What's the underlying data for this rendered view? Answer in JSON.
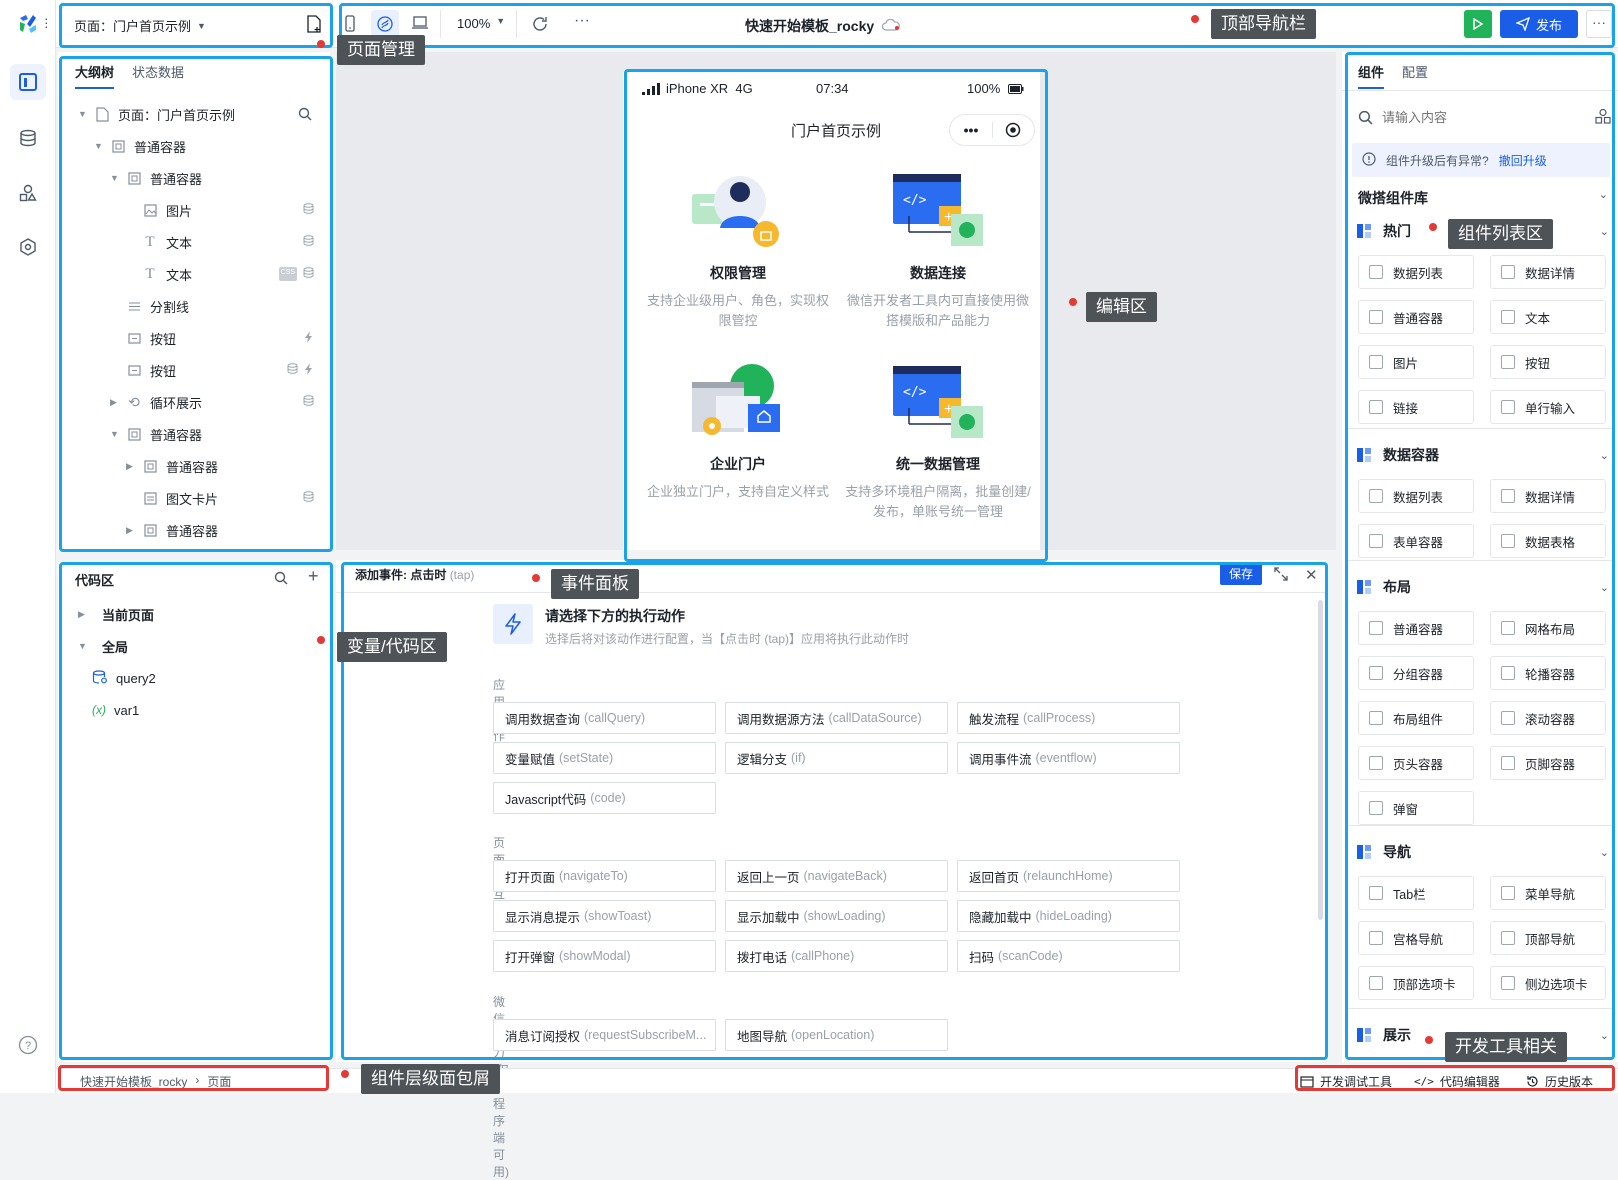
{
  "topbar": {
    "page_selector": "页面：门户首页示例",
    "zoom": "100%",
    "app_title": "快速开始模板_rocky",
    "publish_label": "发布"
  },
  "left_panel": {
    "tabs": [
      "大纲树",
      "状态数据"
    ],
    "tree": [
      {
        "label": "页面：门户首页示例",
        "depth": 0,
        "expand": "open",
        "icon": "page-icon"
      },
      {
        "label": "普通容器",
        "depth": 1,
        "expand": "open",
        "icon": "container-icon"
      },
      {
        "label": "普通容器",
        "depth": 2,
        "expand": "open",
        "icon": "container-icon"
      },
      {
        "label": "图片",
        "depth": 3,
        "expand": "none",
        "icon": "image-icon"
      },
      {
        "label": "文本",
        "depth": 3,
        "expand": "none",
        "icon": "text-icon"
      },
      {
        "label": "文本",
        "depth": 3,
        "expand": "none",
        "icon": "text-icon"
      },
      {
        "label": "分割线",
        "depth": 2,
        "expand": "none",
        "icon": "divider-icon"
      },
      {
        "label": "按钮",
        "depth": 2,
        "expand": "none",
        "icon": "button-icon"
      },
      {
        "label": "按钮",
        "depth": 2,
        "expand": "none",
        "icon": "button-icon"
      },
      {
        "label": "循环展示",
        "depth": 2,
        "expand": "closed",
        "icon": "loop-icon"
      },
      {
        "label": "普通容器",
        "depth": 2,
        "expand": "open",
        "icon": "container-icon"
      },
      {
        "label": "普通容器",
        "depth": 3,
        "expand": "closed",
        "icon": "container-icon"
      },
      {
        "label": "图文卡片",
        "depth": 3,
        "expand": "none",
        "icon": "card-icon"
      },
      {
        "label": "普通容器",
        "depth": 3,
        "expand": "closed",
        "icon": "container-icon"
      }
    ]
  },
  "code_panel": {
    "title": "代码区",
    "items": [
      {
        "label": "当前页面",
        "bold": true
      },
      {
        "label": "全局",
        "bold": true
      },
      {
        "label": "query2",
        "bold": false
      },
      {
        "label": "var1",
        "bold": false
      }
    ]
  },
  "phone": {
    "carrier": "iPhone XR  4G",
    "time": "07:34",
    "battery": "100%",
    "page_title": "门户首页示例",
    "features": [
      {
        "title": "权限管理",
        "desc": "支持企业级用户、角色，实现权限管控"
      },
      {
        "title": "数据连接",
        "desc": "微信开发者工具内可直接使用微搭模版和产品能力"
      },
      {
        "title": "企业门户",
        "desc": "企业独立门户，支持自定义样式"
      },
      {
        "title": "统一数据管理",
        "desc": "支持多环境租户隔离，批量创建/发布，单账号统一管理"
      }
    ]
  },
  "event_panel": {
    "title": "添加事件: 点击时",
    "title_api": "(tap)",
    "save_label": "保存",
    "heading": "请选择下方的执行动作",
    "subheading": "选择后将对该动作进行配置，当【点击时 (tap)】应用将执行此动作时",
    "sections": [
      {
        "title": "应用动作",
        "actions": [
          {
            "label": "调用数据查询",
            "api": "(callQuery)"
          },
          {
            "label": "调用数据源方法",
            "api": "(callDataSource)"
          },
          {
            "label": "触发流程",
            "api": "(callProcess)"
          },
          {
            "label": "变量赋值",
            "api": "(setState)"
          },
          {
            "label": "逻辑分支",
            "api": "(if)"
          },
          {
            "label": "调用事件流",
            "api": "(eventflow)"
          },
          {
            "label": "Javascript代码",
            "api": "(code)"
          }
        ]
      },
      {
        "title": "页面交互",
        "actions": [
          {
            "label": "打开页面",
            "api": "(navigateTo)"
          },
          {
            "label": "返回上一页",
            "api": "(navigateBack)"
          },
          {
            "label": "返回首页",
            "api": "(relaunchHome)"
          },
          {
            "label": "显示消息提示",
            "api": "(showToast)"
          },
          {
            "label": "显示加载中",
            "api": "(showLoading)"
          },
          {
            "label": "隐藏加载中",
            "api": "(hideLoading)"
          },
          {
            "label": "打开弹窗",
            "api": "(showModal)"
          },
          {
            "label": "拨打电话",
            "api": "(callPhone)"
          },
          {
            "label": "扫码",
            "api": "(scanCode)"
          }
        ]
      },
      {
        "title": "微信能力(仅小程序端可用)",
        "actions": [
          {
            "label": "消息订阅授权",
            "api": "(requestSubscribeM..."
          },
          {
            "label": "地图导航",
            "api": "(openLocation)"
          }
        ]
      }
    ]
  },
  "right_panel": {
    "tabs": [
      "组件",
      "配置"
    ],
    "search_placeholder": "请输入内容",
    "notice": "组件升级后有异常?",
    "notice_link": "撤回升级",
    "library_title": "微搭组件库",
    "categories": [
      {
        "title": "热门",
        "items": [
          "数据列表",
          "数据详情",
          "普通容器",
          "文本",
          "图片",
          "按钮",
          "链接",
          "单行输入"
        ]
      },
      {
        "title": "数据容器",
        "items": [
          "数据列表",
          "数据详情",
          "表单容器",
          "数据表格"
        ]
      },
      {
        "title": "布局",
        "items": [
          "普通容器",
          "网格布局",
          "分组容器",
          "轮播容器",
          "布局组件",
          "滚动容器",
          "页头容器",
          "页脚容器",
          "弹窗"
        ]
      },
      {
        "title": "导航",
        "items": [
          "Tab栏",
          "菜单导航",
          "宫格导航",
          "顶部导航",
          "顶部选项卡",
          "侧边选项卡"
        ]
      },
      {
        "title": "展示",
        "items": []
      }
    ]
  },
  "bottom_bar": {
    "breadcrumb": [
      "快速开始模板_rocky",
      "页面"
    ],
    "tools": [
      "开发调试工具",
      "代码编辑器",
      "历史版本"
    ]
  },
  "annotations": {
    "page_mgmt": "页面管理",
    "topnav": "顶部导航栏",
    "edit_area": "编辑区",
    "component_list": "组件列表区",
    "event_panel": "事件面板",
    "var_code": "变量/代码区",
    "breadcrumb": "组件层级面包屑",
    "devtools": "开发工具相关"
  },
  "colors": {
    "brand": "#1a5ee8",
    "run": "#20b35a",
    "annotation_box": "#1aa3e8",
    "annotation_red": "#e53935"
  }
}
